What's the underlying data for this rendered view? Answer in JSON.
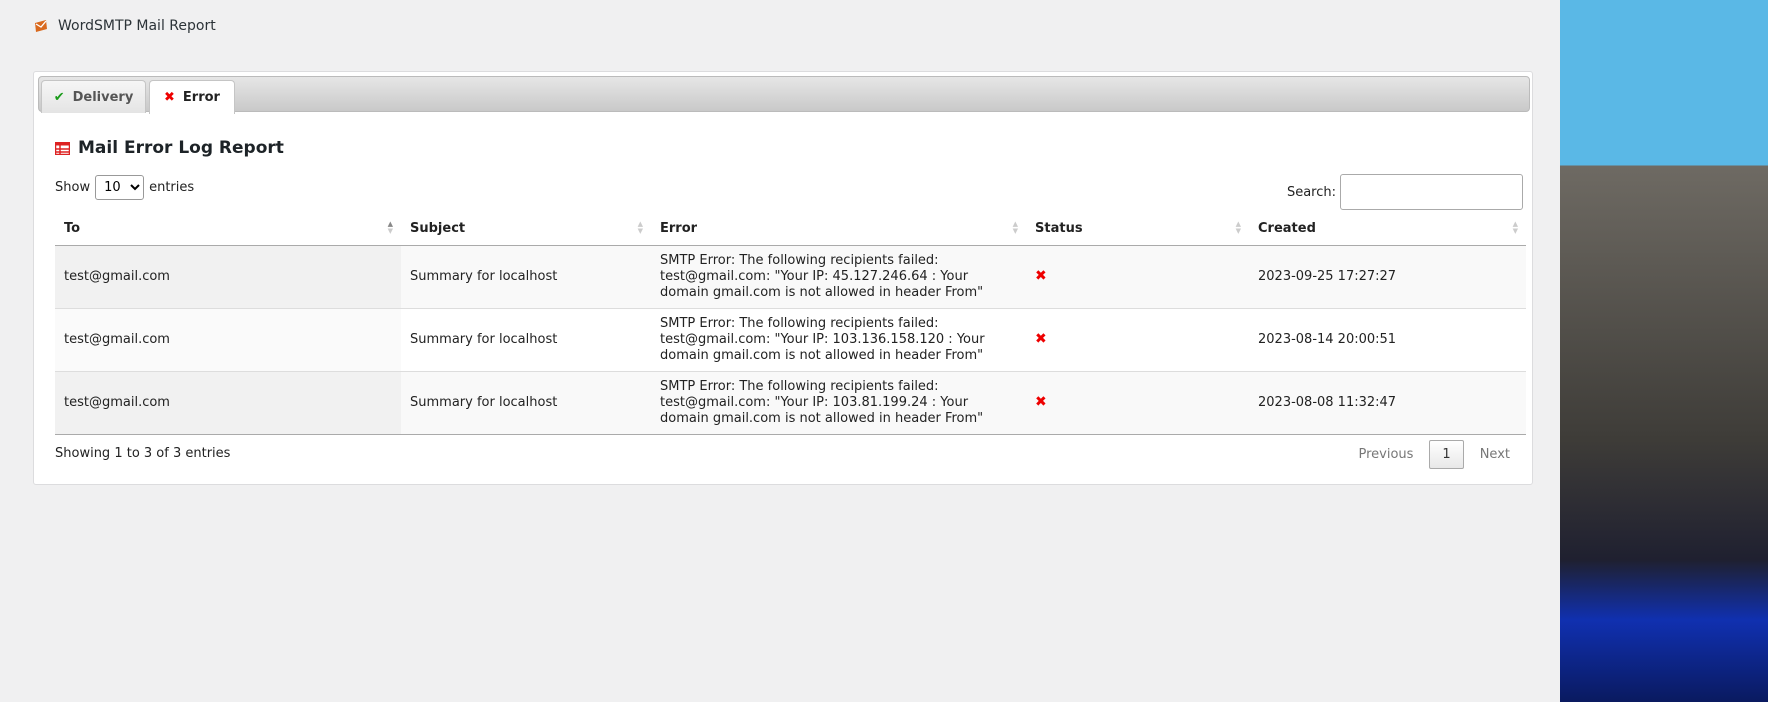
{
  "header": {
    "title": "WordSMTP Mail Report",
    "logo_icon": "envelope-icon"
  },
  "tabs": [
    {
      "label": "Delivery",
      "icon": "check-icon",
      "active": false
    },
    {
      "label": "Error",
      "icon": "x-icon",
      "active": true
    }
  ],
  "section": {
    "title": "Mail Error Log Report",
    "icon": "table-icon"
  },
  "length": {
    "show": "Show",
    "value": "10",
    "entries": "entries"
  },
  "search": {
    "label": "Search:",
    "value": ""
  },
  "columns": [
    "To",
    "Subject",
    "Error",
    "Status",
    "Created"
  ],
  "rows": [
    {
      "to": "test@gmail.com",
      "subject": "Summary for localhost",
      "error": "SMTP Error: The following recipients failed: test@gmail.com: \"Your IP: 45.127.246.64 : Your domain gmail.com is not allowed in header From\"",
      "status": "error",
      "created": "2023-09-25 17:27:27"
    },
    {
      "to": "test@gmail.com",
      "subject": "Summary for localhost",
      "error": "SMTP Error: The following recipients failed: test@gmail.com: \"Your IP: 103.136.158.120 : Your domain gmail.com is not allowed in header From\"",
      "status": "error",
      "created": "2023-08-14 20:00:51"
    },
    {
      "to": "test@gmail.com",
      "subject": "Summary for localhost",
      "error": "SMTP Error: The following recipients failed: test@gmail.com: \"Your IP: 103.81.199.24 : Your domain gmail.com is not allowed in header From\"",
      "status": "error",
      "created": "2023-08-08 11:32:47"
    }
  ],
  "footer": {
    "info": "Showing 1 to 3 of 3 entries",
    "previous": "Previous",
    "page": "1",
    "next": "Next"
  },
  "colors": {
    "accent_error": "#ee0000",
    "success": "#1a9b1a",
    "logo": "#d9691e"
  }
}
